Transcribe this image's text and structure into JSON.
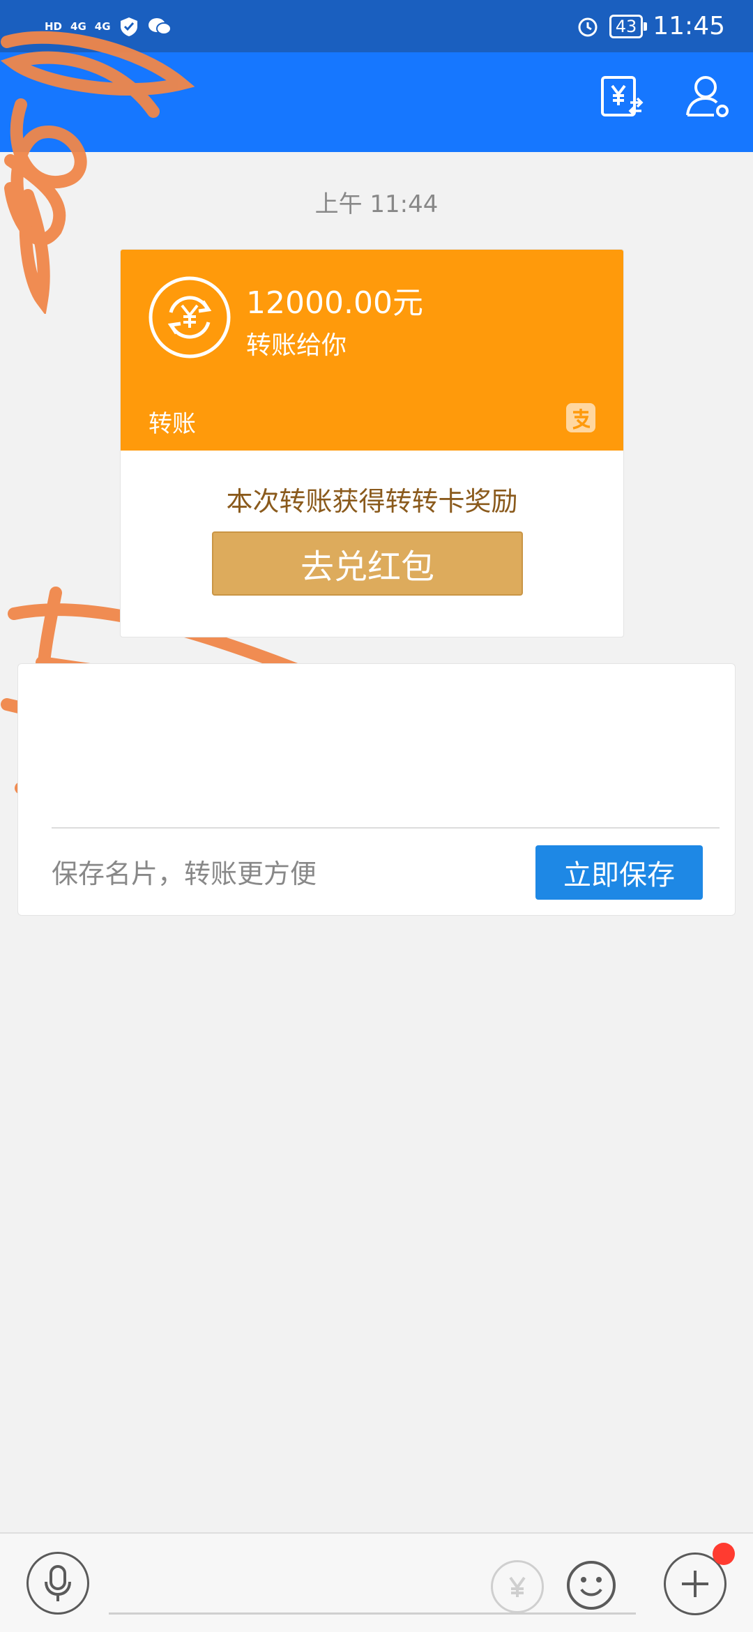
{
  "status_bar": {
    "left_labels": [
      "HD",
      "4G",
      "4G"
    ],
    "battery": "43",
    "time": "11:45"
  },
  "chat": {
    "timestamp": "上午 11:44",
    "transfer": {
      "amount": "12000.00元",
      "subtitle": "转账给你",
      "type_label": "转账",
      "reward_text": "本次转账获得转转卡奖励",
      "redeem_label": "去兑红包"
    },
    "save_contact": {
      "hint": "保存名片，转账更方便",
      "button_label": "立即保存"
    }
  },
  "input_bar": {
    "placeholder": ""
  },
  "colors": {
    "header": "#1677ff",
    "status_bar": "#1a5fbf",
    "transfer_card": "#ff9a0b",
    "redeem_button": "#ddab5c",
    "save_button": "#1e88e5",
    "notification_dot": "#ff3b30"
  },
  "icons": [
    "transfer-money-icon",
    "contact-settings-icon",
    "transfer-circle-icon",
    "alipay-icon",
    "microphone-icon",
    "yuan-transfer-icon",
    "emoji-icon",
    "plus-icon"
  ]
}
